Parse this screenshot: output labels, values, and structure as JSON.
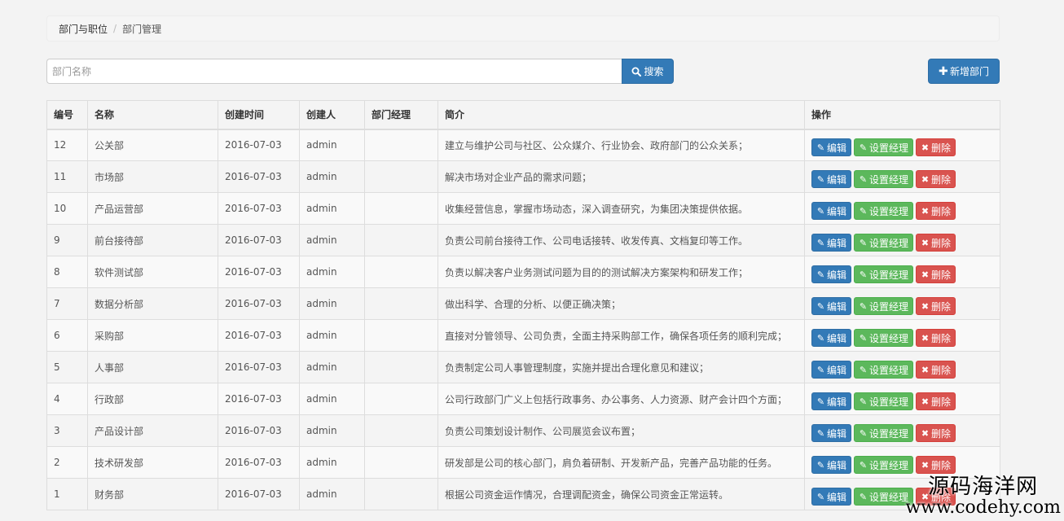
{
  "breadcrumb": {
    "parent": "部门与职位",
    "separator": "/",
    "current": "部门管理"
  },
  "search": {
    "placeholder": "部门名称",
    "value": "",
    "button_label": "搜索"
  },
  "add_button_label": "新增部门",
  "table": {
    "headers": [
      "编号",
      "名称",
      "创建时间",
      "创建人",
      "部门经理",
      "简介",
      "操作"
    ],
    "rows": [
      {
        "id": "12",
        "name": "公关部",
        "created": "2016-07-03",
        "creator": "admin",
        "manager": "",
        "desc": "建立与维护公司与社区、公众媒介、行业协会、政府部门的公众关系；"
      },
      {
        "id": "11",
        "name": "市场部",
        "created": "2016-07-03",
        "creator": "admin",
        "manager": "",
        "desc": "解决市场对企业产品的需求问题；"
      },
      {
        "id": "10",
        "name": "产品运营部",
        "created": "2016-07-03",
        "creator": "admin",
        "manager": "",
        "desc": "收集经营信息，掌握市场动态，深入调查研究，为集团决策提供依据。"
      },
      {
        "id": "9",
        "name": "前台接待部",
        "created": "2016-07-03",
        "creator": "admin",
        "manager": "",
        "desc": "负责公司前台接待工作、公司电话接转、收发传真、文档复印等工作。"
      },
      {
        "id": "8",
        "name": "软件测试部",
        "created": "2016-07-03",
        "creator": "admin",
        "manager": "",
        "desc": "负责以解决客户业务测试问题为目的的测试解决方案架构和研发工作；"
      },
      {
        "id": "7",
        "name": "数据分析部",
        "created": "2016-07-03",
        "creator": "admin",
        "manager": "",
        "desc": "做出科学、合理的分析、以便正确决策；"
      },
      {
        "id": "6",
        "name": "采购部",
        "created": "2016-07-03",
        "creator": "admin",
        "manager": "",
        "desc": "直接对分管领导、公司负责，全面主持采购部工作，确保各项任务的顺利完成；"
      },
      {
        "id": "5",
        "name": "人事部",
        "created": "2016-07-03",
        "creator": "admin",
        "manager": "",
        "desc": "负责制定公司人事管理制度，实施并提出合理化意见和建议；"
      },
      {
        "id": "4",
        "name": "行政部",
        "created": "2016-07-03",
        "creator": "admin",
        "manager": "",
        "desc": "公司行政部门广义上包括行政事务、办公事务、人力资源、财产会计四个方面；"
      },
      {
        "id": "3",
        "name": "产品设计部",
        "created": "2016-07-03",
        "creator": "admin",
        "manager": "",
        "desc": "负责公司策划设计制作、公司展览会议布置；"
      },
      {
        "id": "2",
        "name": "技术研发部",
        "created": "2016-07-03",
        "creator": "admin",
        "manager": "",
        "desc": "研发部是公司的核心部门，肩负着研制、开发新产品，完善产品功能的任务。"
      },
      {
        "id": "1",
        "name": "财务部",
        "created": "2016-07-03",
        "creator": "admin",
        "manager": "",
        "desc": "根据公司资金运作情况，合理调配资金，确保公司资金正常运转。"
      }
    ],
    "actions": {
      "edit": "编辑",
      "set_manager": "设置经理",
      "delete": "删除"
    }
  },
  "icons": {
    "search": "search-icon",
    "add": "plus-icon",
    "edit": "pencil-icon",
    "set_manager": "edit-square-icon",
    "delete": "close-icon"
  },
  "colors": {
    "primary": "#337ab7",
    "success": "#5cb85c",
    "danger": "#d9534f"
  },
  "watermark": {
    "cn": "源码海洋网",
    "url": "www.codehy.com"
  }
}
